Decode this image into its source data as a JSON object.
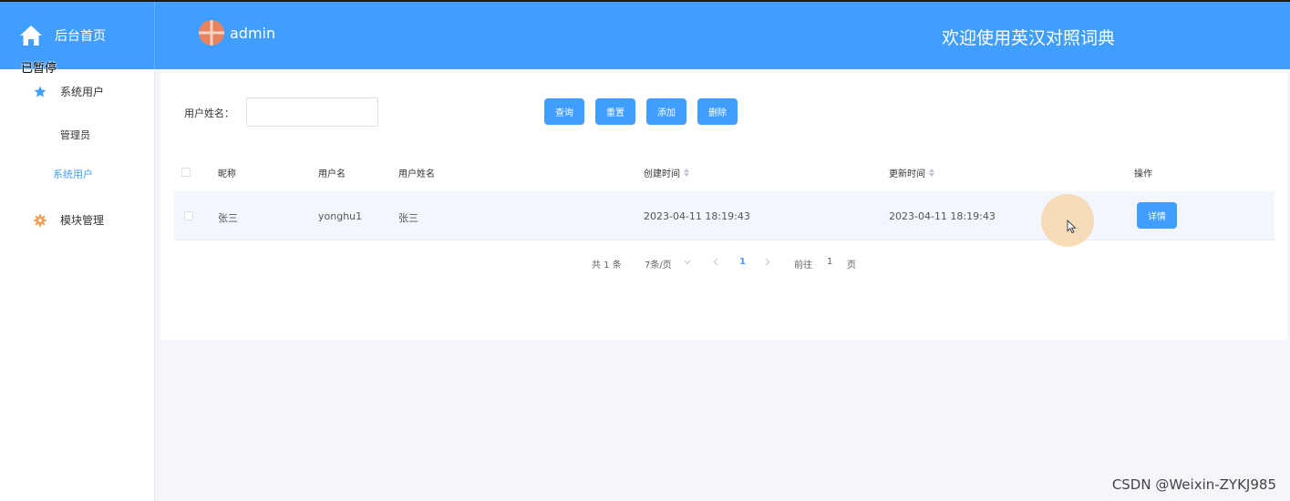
{
  "header": {
    "home_label": "后台首页",
    "user_name": "admin",
    "welcome": "欢迎使用英汉对照词典",
    "accent_color": "#409eff"
  },
  "overlay": {
    "paused_label": "已暂停"
  },
  "sidebar": {
    "groups": [
      {
        "label": "系统用户",
        "icon": "star-icon"
      },
      {
        "label": "模块管理",
        "icon": "gear-icon"
      }
    ],
    "sub_items": [
      {
        "label": "管理员"
      },
      {
        "label": "系统用户",
        "active": true
      }
    ]
  },
  "search": {
    "label": "用户姓名：",
    "value": "",
    "placeholder": ""
  },
  "toolbar": {
    "query": "查询",
    "reset": "重置",
    "add": "添加",
    "delete": "删除"
  },
  "table": {
    "columns": [
      "昵称",
      "用户名",
      "用户姓名",
      "创建时间",
      "更新时间",
      "操作"
    ],
    "rows": [
      {
        "nickname": "张三",
        "username": "yonghu1",
        "realname": "张三",
        "created": "2023-04-11 18:19:43",
        "updated": "2023-04-11 18:19:43",
        "action": "详情"
      }
    ]
  },
  "pagination": {
    "total": "共 1 条",
    "page_size": "7条/页",
    "current_page": "1",
    "goto_prefix": "前往",
    "goto_value": "1",
    "goto_suffix": "页"
  },
  "watermark": "CSDN @Weixin-ZYKJ985"
}
